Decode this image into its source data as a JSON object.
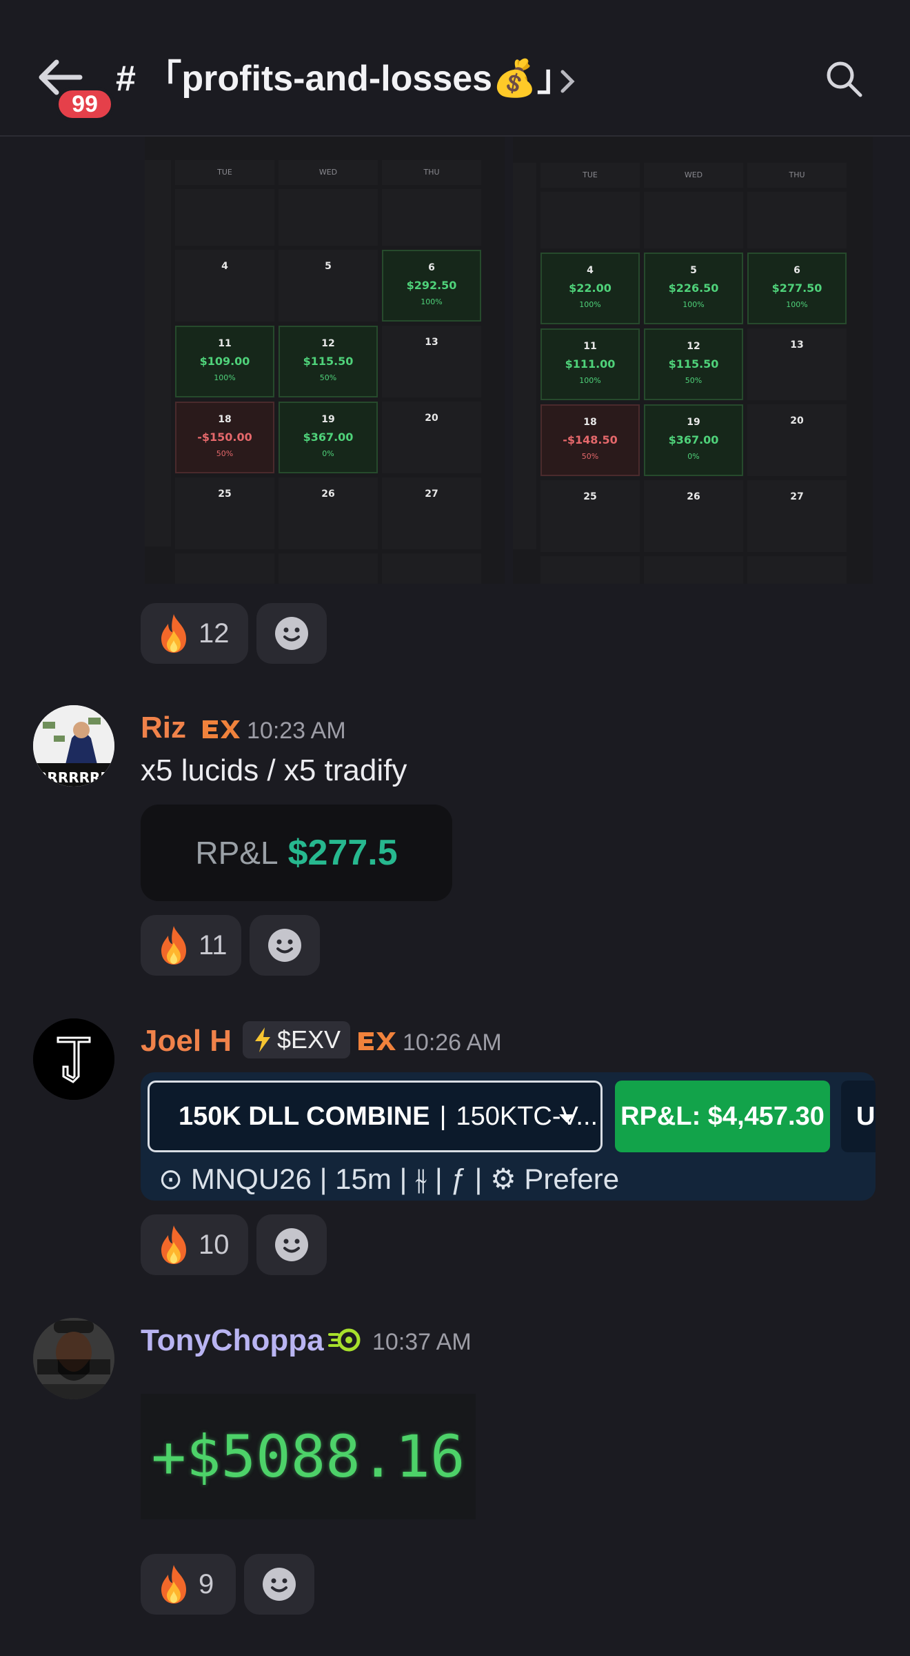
{
  "header": {
    "back_badge": "99",
    "channel_title": "# 「profits-and-losses💰」"
  },
  "calendars": [
    {
      "weekdays": [
        "TUE",
        "WED",
        "THU"
      ],
      "days": [
        {
          "day": "4",
          "amount": "",
          "pct": "",
          "status": "none"
        },
        {
          "day": "5",
          "amount": "",
          "pct": "",
          "status": "none"
        },
        {
          "day": "6",
          "amount": "$292.50",
          "pct": "100%",
          "status": "green"
        },
        {
          "day": "11",
          "amount": "$109.00",
          "pct": "100%",
          "status": "green"
        },
        {
          "day": "12",
          "amount": "$115.50",
          "pct": "50%",
          "status": "green"
        },
        {
          "day": "13",
          "amount": "",
          "pct": "",
          "status": "none"
        },
        {
          "day": "18",
          "amount": "-$150.00",
          "pct": "50%",
          "status": "red"
        },
        {
          "day": "19",
          "amount": "$367.00",
          "pct": "0%",
          "status": "green"
        },
        {
          "day": "20",
          "amount": "",
          "pct": "",
          "status": "none"
        },
        {
          "day": "25",
          "amount": "",
          "pct": "",
          "status": "none"
        },
        {
          "day": "26",
          "amount": "",
          "pct": "",
          "status": "none"
        },
        {
          "day": "27",
          "amount": "",
          "pct": "",
          "status": "none"
        }
      ]
    },
    {
      "weekdays": [
        "TUE",
        "WED",
        "THU"
      ],
      "days": [
        {
          "day": "4",
          "amount": "$22.00",
          "pct": "100%",
          "status": "green"
        },
        {
          "day": "5",
          "amount": "$226.50",
          "pct": "100%",
          "status": "green"
        },
        {
          "day": "6",
          "amount": "$277.50",
          "pct": "100%",
          "status": "green"
        },
        {
          "day": "11",
          "amount": "$111.00",
          "pct": "100%",
          "status": "green"
        },
        {
          "day": "12",
          "amount": "$115.50",
          "pct": "50%",
          "status": "green"
        },
        {
          "day": "13",
          "amount": "",
          "pct": "",
          "status": "none"
        },
        {
          "day": "18",
          "amount": "-$148.50",
          "pct": "50%",
          "status": "red"
        },
        {
          "day": "19",
          "amount": "$367.00",
          "pct": "0%",
          "status": "green"
        },
        {
          "day": "20",
          "amount": "",
          "pct": "",
          "status": "none"
        },
        {
          "day": "25",
          "amount": "",
          "pct": "",
          "status": "none"
        },
        {
          "day": "26",
          "amount": "",
          "pct": "",
          "status": "none"
        },
        {
          "day": "27",
          "amount": "",
          "pct": "",
          "status": "none"
        }
      ]
    }
  ],
  "reactions": {
    "first": {
      "emoji": "fire-icon",
      "count": "12"
    },
    "riz": {
      "emoji": "fire-icon",
      "count": "11"
    },
    "joel": {
      "emoji": "fire-icon",
      "count": "10"
    },
    "tony": {
      "emoji": "fire-icon",
      "count": "9"
    }
  },
  "messages": {
    "riz": {
      "username": "Riz",
      "username_color": "#f0824a",
      "time": "10:23 AM",
      "text": "x5 lucids / x5 tradify",
      "rpl_label": "RP&L",
      "rpl_value": "$277.5"
    },
    "joel": {
      "username": "Joel H",
      "username_color": "#f0824a",
      "tag": "$EXV",
      "time": "10:26 AM",
      "combine_name": "150K DLL COMBINE",
      "combine_account": "150KTC-V...",
      "combine_rpl": "RP&L: $4,457.30",
      "combine_cut": "UI",
      "combine_toolbar": "⊙ MNQU26   |   15m   |   ⫳   |   ƒ   |   ⚙ Prefere"
    },
    "tony": {
      "username": "TonyChoppa",
      "time": "10:37 AM",
      "pnl": "+$5088.16"
    }
  },
  "colors": {
    "background": "#1b1b21",
    "profit_green": "#4fd27a",
    "loss_red": "#e5686b",
    "badge_red": "#e5404a"
  }
}
